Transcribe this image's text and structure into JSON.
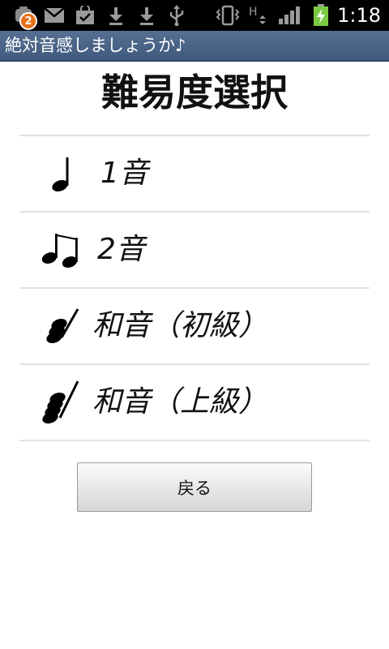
{
  "status_bar": {
    "notification_count": "2",
    "time": "1:18",
    "network_label": "H",
    "icons": [
      "app-notification-icon",
      "gmail-icon",
      "market-icon",
      "download-icon",
      "download-icon",
      "usb-icon",
      "vibrate-icon",
      "network-h-icon",
      "signal-icon",
      "battery-charging-icon"
    ],
    "battery_color": "#7ac943"
  },
  "app": {
    "title": "絶対音感しましょうか♪",
    "title_bar_color": "#4a6487"
  },
  "screen": {
    "heading": "難易度選択"
  },
  "levels": [
    {
      "label": "1音",
      "icon": "quarter-note-icon"
    },
    {
      "label": "2音",
      "icon": "double-note-icon"
    },
    {
      "label": "和音（初級）",
      "icon": "chord-three-notes-icon"
    },
    {
      "label": "和音（上級）",
      "icon": "chord-four-notes-icon"
    }
  ],
  "back_button": {
    "label": "戻る"
  }
}
